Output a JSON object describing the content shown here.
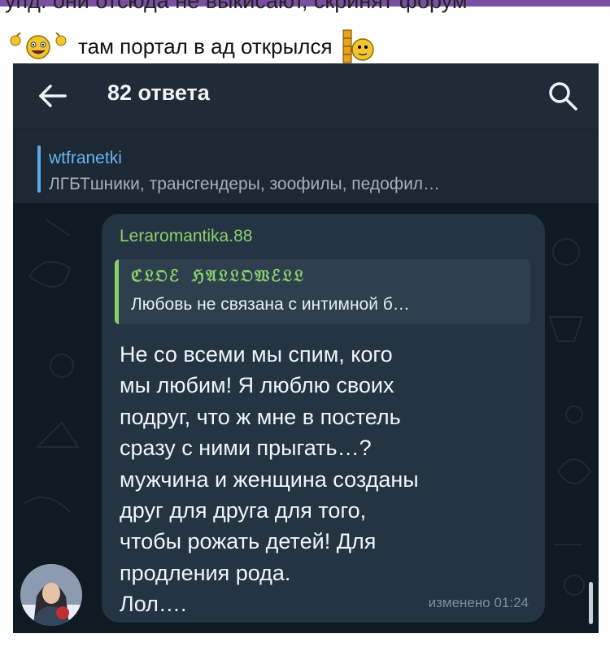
{
  "post": {
    "top_line_partial": "упд: они отсюда не выкисают, скринят форум",
    "caption": "там портал в ад открылся"
  },
  "icons": {
    "emoji_left": "cheering-smiley-icon",
    "emoji_right": "smiley-with-door-icon",
    "back": "arrow-left-icon",
    "search": "search-icon"
  },
  "app": {
    "title": "82 ответа"
  },
  "reply_header": {
    "channel": "wtfranetki",
    "text": "ЛГБТшники, трансгендеры, зоофилы, педофил…"
  },
  "message": {
    "sender": "Leraromantika.88",
    "quote_author": "ℭ𝔏𝔒ℰ ℌ𝔄𝔏𝔏𝔒𝔚ℰ𝔏𝔏",
    "quote_text": "Любовь не связана с интимной б…",
    "body": "Не со всеми мы спим, кого\nмы любим! Я люблю своих\nподруг, что ж мне в постель\nсразу с ними прыгать…?\nмужчина и женщина созданы\nдруг для друга для того,\nчтобы рожать детей! Для\nпродления рода.\nЛол….",
    "edited": "изменено 01:24"
  },
  "colors": {
    "accent_blue": "#5fa8e8",
    "sender_green": "#8ad16b",
    "bubble": "#243443",
    "chat_background": "#0f1a22"
  }
}
